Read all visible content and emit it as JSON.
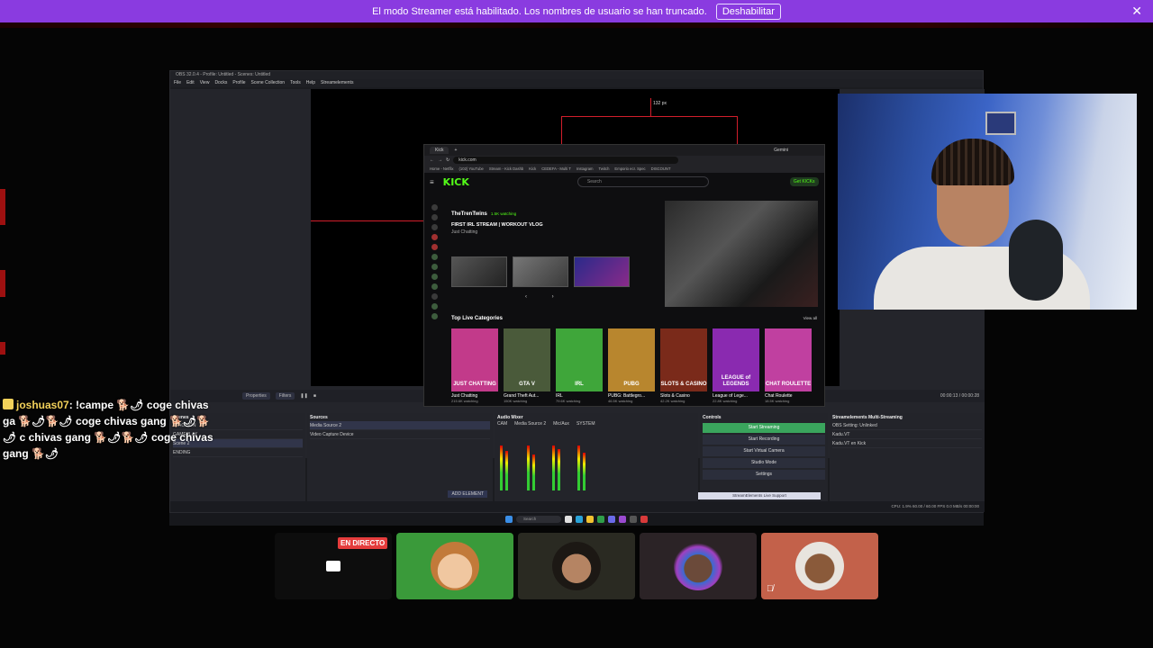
{
  "banner": {
    "message": "El modo Streamer está habilitado. Los nombres de usuario se han truncado.",
    "button": "Deshabilitar",
    "close": "✕",
    "color": "#8a3be0"
  },
  "obs": {
    "title": "OBS 32.0.4 - Profile: Untitled - Scenes: Untitled",
    "menu": [
      "File",
      "Edit",
      "View",
      "Docks",
      "Profile",
      "Scene Collection",
      "Tools",
      "Help",
      "Streamelements"
    ],
    "px_label": "132 px",
    "toolbar": {
      "properties": "Properties",
      "filters": "Filters",
      "time": "00:00:13 / 00:00:28"
    },
    "sources": {
      "title": "Sources",
      "items": [
        "Media Source 2",
        "Video Capture Device"
      ],
      "add": "ADD ELEMENT"
    },
    "scenes": {
      "title": "Scenes",
      "items": [
        "STACCION",
        "GAMEPLAY",
        "Scene 2",
        "ENDING"
      ]
    },
    "mixer": {
      "title": "Audio Mixer",
      "channels": [
        "CAM",
        "Media Source 2",
        "Mic/Aux",
        "SYSTEM"
      ]
    },
    "controls": {
      "title": "Controls",
      "buttons": [
        "Start Streaming",
        "Start Recording",
        "Start Virtual Camera",
        "Studio Mode",
        "Settings"
      ],
      "support": "StreamElements Live Support"
    },
    "multistream": {
      "title": "Streamelements Multi-Streaming",
      "items": [
        "OBS Setting: Unlinked",
        "Kadu.VT",
        "Kadu.VT en Kick"
      ]
    },
    "status": "CPU: 1.9%   60.00 / 60.00 FPS   0.0 MB/s   00:00:00",
    "taskbar_search": "Search"
  },
  "browser": {
    "tab": "Kick",
    "gemini": "Gemini",
    "url": "kick.com",
    "bookmarks": [
      "Home - Netflix",
      "(102) YouTube",
      "Stream - Kick Dashb",
      "Kick",
      "CEDEFA - Multi T",
      "Instagram",
      "Twitch",
      "Emporio ecr. Spec",
      "DISCOUNT"
    ],
    "search_placeholder": "Search",
    "get_kicks": "Get KICKs",
    "streamer": "TheTrenTwins",
    "watching": "1.5K watching",
    "stream_title": "FIRST IRL STREAM | WORKOUT VLOG",
    "stream_category": "Just Chatting",
    "top_categories": "Top Live Categories",
    "view_all": "View all",
    "categories": [
      {
        "name": "Just Chatting",
        "viewers": "215.6K watching",
        "art": "JUST CHATTING",
        "bg": "#c23a8a"
      },
      {
        "name": "Grand Theft Aut...",
        "viewers": "150K watching",
        "art": "GTA V",
        "bg": "#4a5a3a"
      },
      {
        "name": "IRL",
        "viewers": "79.6K watching",
        "art": "IRL",
        "bg": "#3fa63a"
      },
      {
        "name": "PUBG: Battlegro...",
        "viewers": "46.5K watching",
        "art": "PUBG",
        "bg": "#b8862e"
      },
      {
        "name": "Slots & Casino",
        "viewers": "42.2K watching",
        "art": "SLOTS & CASINO",
        "bg": "#7a2a1a"
      },
      {
        "name": "League of Lege...",
        "viewers": "22.8K watching",
        "art": "LEAGUE of LEGENDS",
        "bg": "#8a2ab0"
      },
      {
        "name": "Chat Roulette",
        "viewers": "18.5K watching",
        "art": "CHAT ROULETTE",
        "bg": "#c040a0"
      }
    ]
  },
  "chat": {
    "user": "joshuas07",
    "message": ": !campe 🐕🌶 coge chivas ga 🐕🌶🐕🌶 coge chivas gang 🐕🌶🐕🌶 c chivas gang 🐕🌶🐕🌶 coge chivas gang 🐕🌶"
  },
  "participants": {
    "live_label": "EN DIRECTO",
    "colors": [
      "#0d0d0d",
      "#3a9a3a",
      "#2a2a22",
      "#2b2326",
      "#c3614a"
    ]
  }
}
